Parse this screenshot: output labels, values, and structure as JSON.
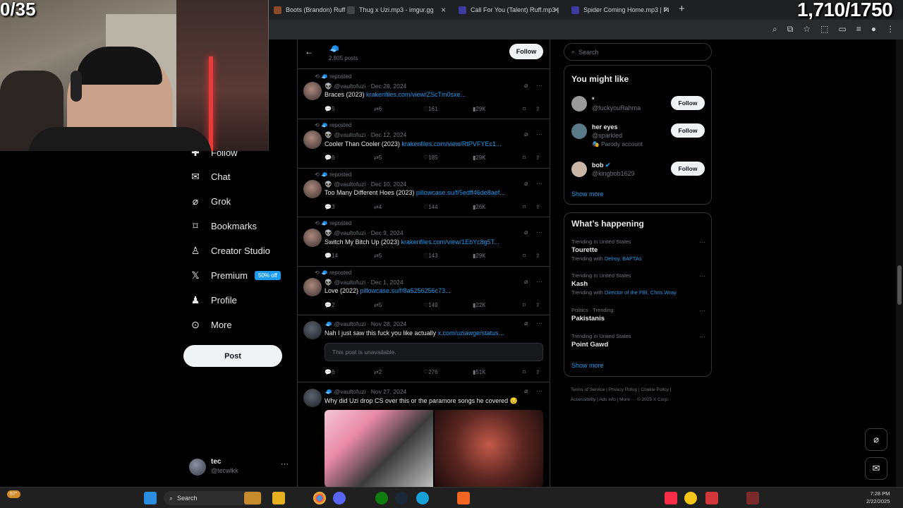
{
  "overlay": {
    "counter_left": "0/35",
    "counter_right": "1,710/1750"
  },
  "browser": {
    "tabs": [
      {
        "label": "Boots (Brandon) Ruff...",
        "color": "#8a4a2a"
      },
      {
        "label": "Thug x Uzi.mp3 - imgur.gg",
        "color": "#444"
      },
      {
        "label": "Call For You (Talent) Ruff.mp3 |",
        "color": "#3b3ba0"
      },
      {
        "label": "Spider Coming Home.mp3 | Pi",
        "color": "#3b3ba0"
      }
    ]
  },
  "nav": {
    "items": [
      {
        "label": "Follow",
        "icon": "follow-icon"
      },
      {
        "label": "Chat",
        "icon": "mail-icon"
      },
      {
        "label": "Grok",
        "icon": "grok-icon"
      },
      {
        "label": "Bookmarks",
        "icon": "bookmark-icon"
      },
      {
        "label": "Creator Studio",
        "icon": "creator-icon"
      },
      {
        "label": "Premium",
        "icon": "x-logo-icon",
        "badge": "50% off"
      },
      {
        "label": "Profile",
        "icon": "profile-icon"
      },
      {
        "label": "More",
        "icon": "more-circle-icon"
      }
    ],
    "post_label": "Post",
    "account": {
      "name": "tec",
      "handle": "@tecwlkk"
    }
  },
  "feed": {
    "header": {
      "posts_count": "2,805 posts",
      "follow_label": "Follow"
    },
    "tweets": [
      {
        "repost": "reposted",
        "handle": "@vaultofuzi",
        "date": "Dec 28, 2024",
        "text": "Braces (2023) ",
        "link": "krakenfiles.com/view/ZScTm0sxe...",
        "replies": "5",
        "retweets": "6",
        "likes": "161",
        "views": "29K"
      },
      {
        "repost": "reposted",
        "handle": "@vaultofuzi",
        "date": "Dec 12, 2024",
        "text": "Cooler Than Cooler (2023) ",
        "link": "krakenfiles.com/view/RtPVFYEc1...",
        "replies": "6",
        "retweets": "5",
        "likes": "185",
        "views": "29K"
      },
      {
        "repost": "reposted",
        "handle": "@vaultofuzi",
        "date": "Dec 10, 2024",
        "text": "Too Many Different Hoes (2023) ",
        "link": "pillowcase.su/f/5edff46de8aef...",
        "replies": "3",
        "retweets": "4",
        "likes": "144",
        "views": "26K"
      },
      {
        "repost": "reposted",
        "handle": "@vaultofuzi",
        "date": "Dec 9, 2024",
        "text": "Switch My Bitch Up (2023) ",
        "link": "krakenfiles.com/view/1EbYc8g5T...",
        "replies": "14",
        "retweets": "5",
        "likes": "143",
        "views": "29K"
      },
      {
        "repost": "reposted",
        "handle": "@vaultofuzi",
        "date": "Dec 1, 2024",
        "text": "Love (2022) ",
        "link": "pillowcase.su/f/8a5256256c73...",
        "replies": "2",
        "retweets": "5",
        "likes": "149",
        "views": "22K"
      },
      {
        "repost": "",
        "handle": "@vaultofuzi",
        "date": "Nov 28, 2024",
        "text": "Nah I just saw this fuck you like actually ",
        "link": "x.com/uziawge/status...",
        "unavailable": "This post is unavailable.",
        "replies": "6",
        "retweets": "2",
        "likes": "276",
        "views": "51K"
      },
      {
        "repost": "",
        "handle": "@vaultofuzi",
        "date": "Nov 27, 2024",
        "text": "Why did Uzi drop CS over this or the paramore songs he covered 😔",
        "link": ""
      }
    ]
  },
  "sidebar": {
    "search_placeholder": "Search",
    "you_might_like": {
      "title": "You might like",
      "users": [
        {
          "name": "*",
          "handle": "@fuckyouRahma",
          "extra": "",
          "follow": "Follow",
          "color": "#9a9a9a"
        },
        {
          "name": "her eyes",
          "handle": "@sparkled",
          "extra": "Parody account",
          "follow": "Follow",
          "color": "#5a7a8a"
        },
        {
          "name": "bob",
          "handle": "@kingbob1629",
          "extra": "",
          "follow": "Follow",
          "color": "#c9b6a6"
        }
      ],
      "show_more": "Show more"
    },
    "whats_happening": {
      "title": "What’s happening",
      "trends": [
        {
          "context": "Trending in United States",
          "title": "Tourette",
          "with_prefix": "Trending with ",
          "with": "Delroy, BAFTAs"
        },
        {
          "context": "Trending in United States",
          "title": "Kash",
          "with_prefix": "Trending with ",
          "with": "Director of the FBI, Chris Wray"
        },
        {
          "context": "Politics · Trending",
          "title": "Pakistanis",
          "with_prefix": "",
          "with": ""
        },
        {
          "context": "Trending in United States",
          "title": "Point Gawd",
          "with_prefix": "",
          "with": ""
        }
      ],
      "show_more": "Show more"
    },
    "footer": {
      "line1": "Terms of Service  |  Privacy Policy  |  Cookie Policy  |",
      "line2": "Accessibility  |  Ads info  |  More ···  © 2025 X Corp."
    }
  },
  "taskbar": {
    "search_label": "Search",
    "weather": "57°",
    "time": "7:28 PM",
    "date": "2/22/2025"
  }
}
